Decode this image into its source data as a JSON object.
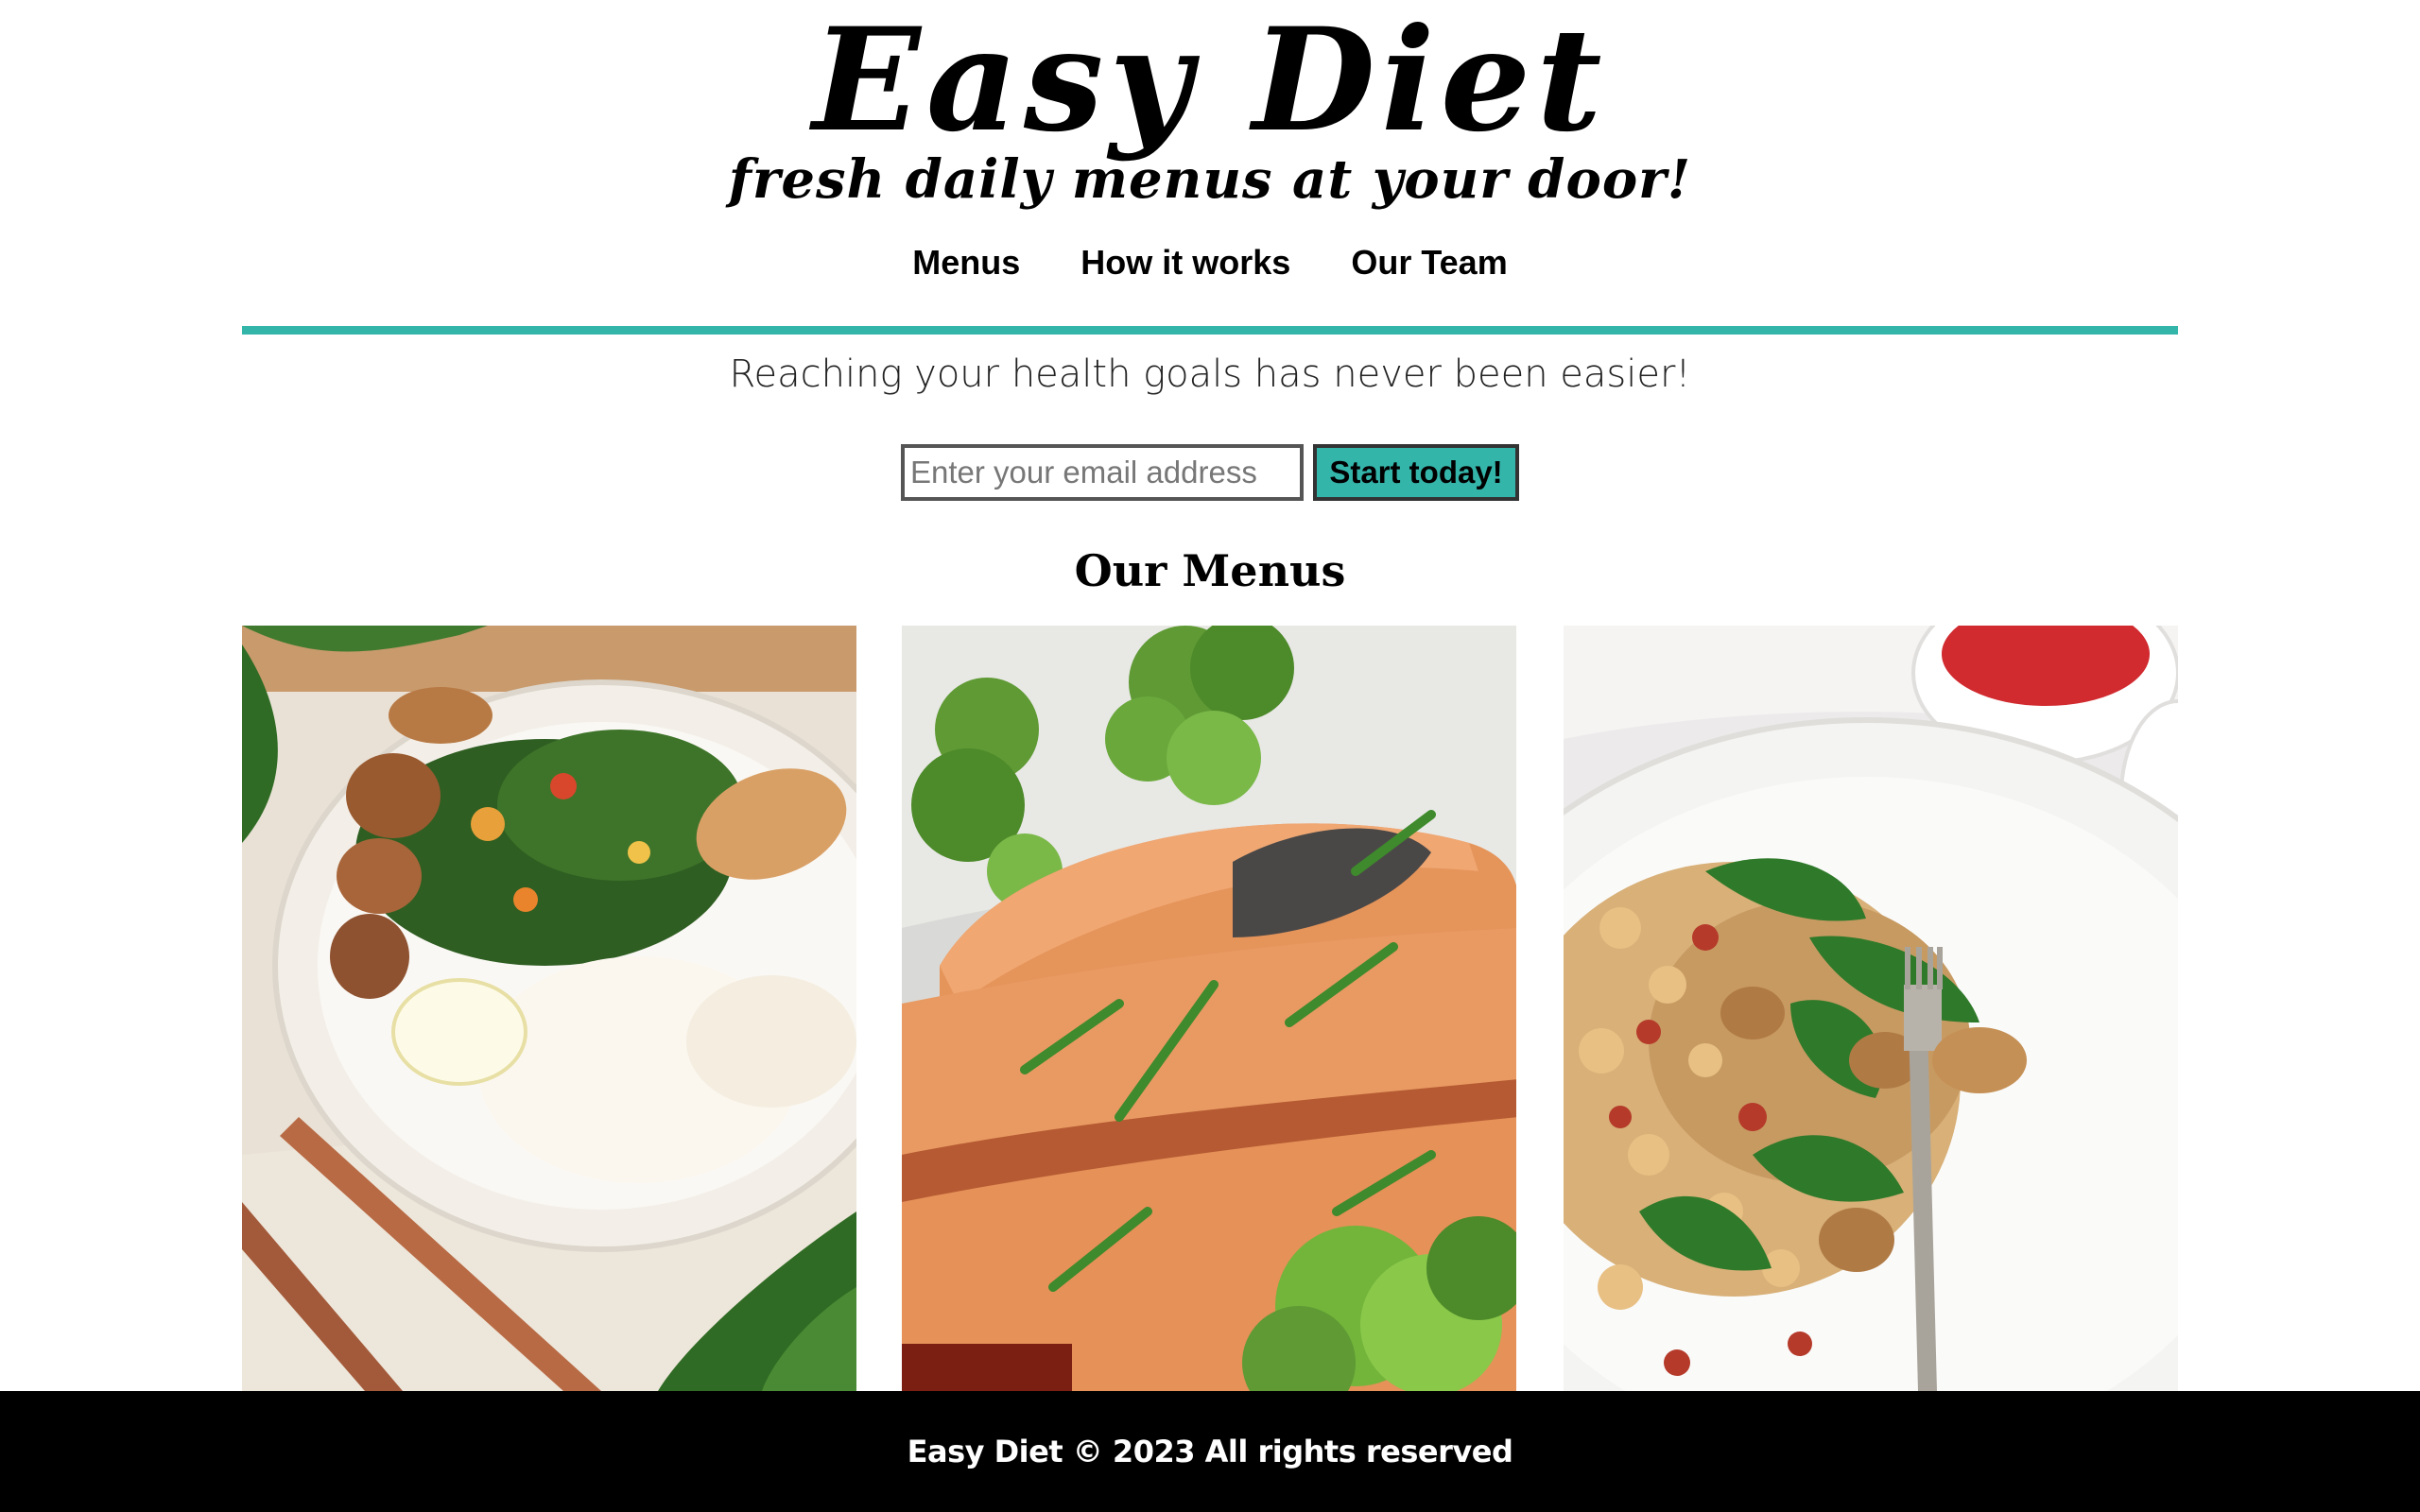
{
  "brand": {
    "title": "Easy Diet",
    "tagline": "fresh daily menus at your door!"
  },
  "nav": {
    "items": [
      "Menus",
      "How it works",
      "Our Team"
    ]
  },
  "hero": {
    "subtitle": "Reaching your health goals has never been easier!",
    "email_placeholder": "Enter your email address",
    "cta_label": "Start today!"
  },
  "menus": {
    "title": "Our Menus",
    "cards": [
      {
        "image": "fish-potatoes-greens-plate"
      },
      {
        "image": "salmon-broccoli-plate"
      },
      {
        "image": "chickpea-cauliflower-salad-plate"
      }
    ]
  },
  "footer": {
    "text": "Easy Diet © 2023 All rights reserved"
  },
  "colors": {
    "accent": "#34b5aa",
    "footer_bg": "#000000",
    "footer_text": "#ffffff"
  }
}
